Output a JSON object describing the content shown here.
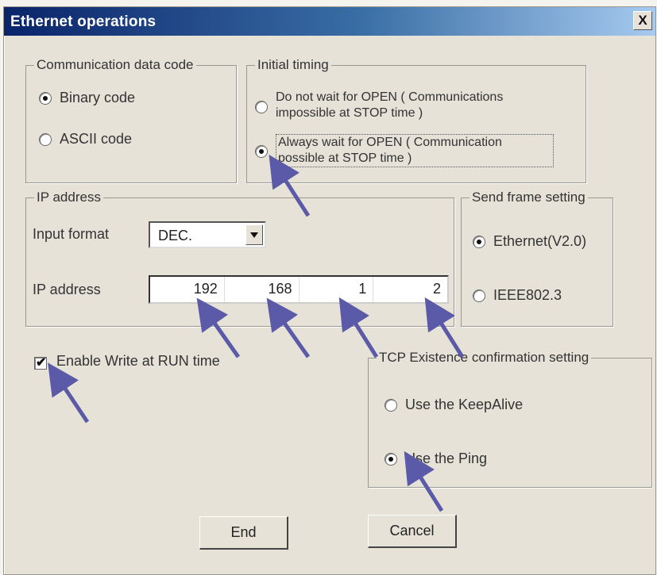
{
  "window": {
    "title": "Ethernet operations",
    "close_glyph": "X"
  },
  "comm_code": {
    "legend": "Communication data code",
    "binary_label": "Binary code",
    "ascii_label": "ASCII code",
    "selected": "Binary code"
  },
  "initial_timing": {
    "legend": "Initial timing",
    "opt1_line1": "Do not wait for OPEN ( Communications",
    "opt1_line2": "impossible at STOP time )",
    "opt2_line1": "Always wait for OPEN ( Communication",
    "opt2_line2": "possible at STOP time )",
    "selected": "Always wait for OPEN"
  },
  "ip": {
    "legend": "IP address",
    "input_format_label": "Input format",
    "input_format_value": "DEC.",
    "ip_label": "IP address",
    "octets": [
      "192",
      "168",
      "1",
      "2"
    ]
  },
  "send_frame": {
    "legend": "Send frame setting",
    "opt1": "Ethernet(V2.0)",
    "opt2": "IEEE802.3",
    "selected": "Ethernet(V2.0)"
  },
  "enable_write": {
    "label": "Enable Write at RUN time",
    "checked": true
  },
  "tcp": {
    "legend": "TCP Existence confirmation setting",
    "opt1": "Use the KeepAlive",
    "opt2": "Use the Ping",
    "selected": "Use the Ping"
  },
  "buttons": {
    "end": "End",
    "cancel": "Cancel"
  },
  "colors": {
    "title_start": "#0a246a",
    "title_end": "#a6caf0",
    "arrow": "#5a5aa8",
    "dialog_bg": "#e6e2d8"
  }
}
